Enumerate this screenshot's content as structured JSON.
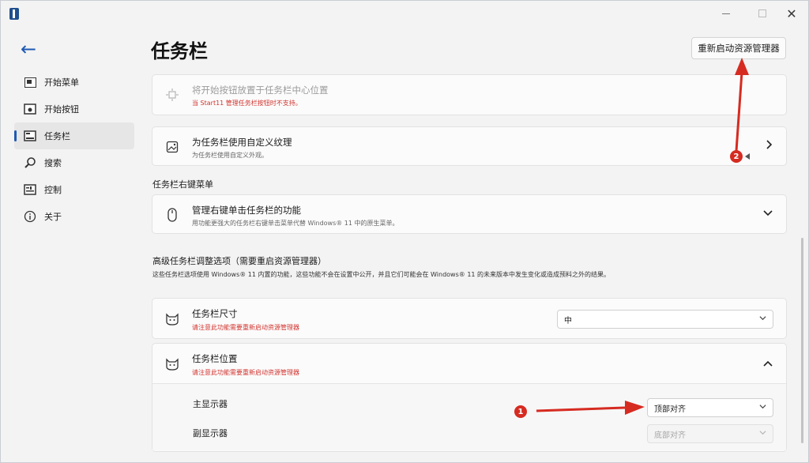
{
  "window": {
    "close_glyph": "✕"
  },
  "sidebar": {
    "back_glyph": "←",
    "items": [
      {
        "label": "开始菜单",
        "icon": "start-menu-icon"
      },
      {
        "label": "开始按钮",
        "icon": "start-button-icon"
      },
      {
        "label": "任务栏",
        "icon": "taskbar-icon"
      },
      {
        "label": "搜索",
        "icon": "search-icon"
      },
      {
        "label": "控制",
        "icon": "control-icon"
      },
      {
        "label": "关于",
        "icon": "info-icon"
      }
    ],
    "active_index": 2
  },
  "main": {
    "title": "任务栏",
    "restart_button": "重新启动资源管理器",
    "center_start": {
      "title": "将开始按钮放置于任务栏中心位置",
      "subtitle": "当 Start11 管理任务栏按钮时不支持。"
    },
    "custom_texture": {
      "title": "为任务栏使用自定义纹理",
      "subtitle": "为任务栏使用自定义外观。"
    },
    "context_menu_section": "任务栏右键菜单",
    "context_menu": {
      "title": "管理右键单击任务栏的功能",
      "subtitle": "用功能更强大的任务栏右键单击菜单代替 Windows® 11 中的原生菜单。"
    },
    "advanced_section": "高级任务栏调整选项（需要重启资源管理器）",
    "advanced_desc": "这些任务栏选项使用 Windows® 11 内置的功能，这些功能不会在设置中公开，并且它们可能会在 Windows® 11 的未来版本中发生变化或造成预料之外的结果。",
    "taskbar_size": {
      "title": "任务栏尺寸",
      "warning": "请注意此功能需要重新启动资源管理器",
      "value": "中"
    },
    "taskbar_position": {
      "title": "任务栏位置",
      "warning": "请注意此功能需要重新启动资源管理器",
      "primary_label": "主显示器",
      "primary_value": "顶部对齐",
      "secondary_label": "副显示器",
      "secondary_value": "底部对齐"
    }
  },
  "annotations": {
    "badge1": "1",
    "badge2": "2",
    "arrow_color": "#d62b21"
  }
}
